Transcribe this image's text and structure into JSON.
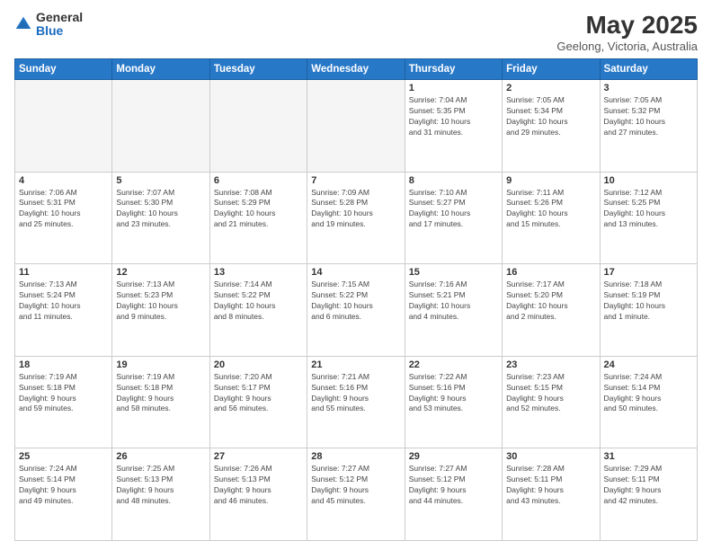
{
  "header": {
    "logo_general": "General",
    "logo_blue": "Blue",
    "title": "May 2025",
    "subtitle": "Geelong, Victoria, Australia"
  },
  "weekdays": [
    "Sunday",
    "Monday",
    "Tuesday",
    "Wednesday",
    "Thursday",
    "Friday",
    "Saturday"
  ],
  "weeks": [
    [
      {
        "day": "",
        "detail": ""
      },
      {
        "day": "",
        "detail": ""
      },
      {
        "day": "",
        "detail": ""
      },
      {
        "day": "",
        "detail": ""
      },
      {
        "day": "1",
        "detail": "Sunrise: 7:04 AM\nSunset: 5:35 PM\nDaylight: 10 hours\nand 31 minutes."
      },
      {
        "day": "2",
        "detail": "Sunrise: 7:05 AM\nSunset: 5:34 PM\nDaylight: 10 hours\nand 29 minutes."
      },
      {
        "day": "3",
        "detail": "Sunrise: 7:05 AM\nSunset: 5:32 PM\nDaylight: 10 hours\nand 27 minutes."
      }
    ],
    [
      {
        "day": "4",
        "detail": "Sunrise: 7:06 AM\nSunset: 5:31 PM\nDaylight: 10 hours\nand 25 minutes."
      },
      {
        "day": "5",
        "detail": "Sunrise: 7:07 AM\nSunset: 5:30 PM\nDaylight: 10 hours\nand 23 minutes."
      },
      {
        "day": "6",
        "detail": "Sunrise: 7:08 AM\nSunset: 5:29 PM\nDaylight: 10 hours\nand 21 minutes."
      },
      {
        "day": "7",
        "detail": "Sunrise: 7:09 AM\nSunset: 5:28 PM\nDaylight: 10 hours\nand 19 minutes."
      },
      {
        "day": "8",
        "detail": "Sunrise: 7:10 AM\nSunset: 5:27 PM\nDaylight: 10 hours\nand 17 minutes."
      },
      {
        "day": "9",
        "detail": "Sunrise: 7:11 AM\nSunset: 5:26 PM\nDaylight: 10 hours\nand 15 minutes."
      },
      {
        "day": "10",
        "detail": "Sunrise: 7:12 AM\nSunset: 5:25 PM\nDaylight: 10 hours\nand 13 minutes."
      }
    ],
    [
      {
        "day": "11",
        "detail": "Sunrise: 7:13 AM\nSunset: 5:24 PM\nDaylight: 10 hours\nand 11 minutes."
      },
      {
        "day": "12",
        "detail": "Sunrise: 7:13 AM\nSunset: 5:23 PM\nDaylight: 10 hours\nand 9 minutes."
      },
      {
        "day": "13",
        "detail": "Sunrise: 7:14 AM\nSunset: 5:22 PM\nDaylight: 10 hours\nand 8 minutes."
      },
      {
        "day": "14",
        "detail": "Sunrise: 7:15 AM\nSunset: 5:22 PM\nDaylight: 10 hours\nand 6 minutes."
      },
      {
        "day": "15",
        "detail": "Sunrise: 7:16 AM\nSunset: 5:21 PM\nDaylight: 10 hours\nand 4 minutes."
      },
      {
        "day": "16",
        "detail": "Sunrise: 7:17 AM\nSunset: 5:20 PM\nDaylight: 10 hours\nand 2 minutes."
      },
      {
        "day": "17",
        "detail": "Sunrise: 7:18 AM\nSunset: 5:19 PM\nDaylight: 10 hours\nand 1 minute."
      }
    ],
    [
      {
        "day": "18",
        "detail": "Sunrise: 7:19 AM\nSunset: 5:18 PM\nDaylight: 9 hours\nand 59 minutes."
      },
      {
        "day": "19",
        "detail": "Sunrise: 7:19 AM\nSunset: 5:18 PM\nDaylight: 9 hours\nand 58 minutes."
      },
      {
        "day": "20",
        "detail": "Sunrise: 7:20 AM\nSunset: 5:17 PM\nDaylight: 9 hours\nand 56 minutes."
      },
      {
        "day": "21",
        "detail": "Sunrise: 7:21 AM\nSunset: 5:16 PM\nDaylight: 9 hours\nand 55 minutes."
      },
      {
        "day": "22",
        "detail": "Sunrise: 7:22 AM\nSunset: 5:16 PM\nDaylight: 9 hours\nand 53 minutes."
      },
      {
        "day": "23",
        "detail": "Sunrise: 7:23 AM\nSunset: 5:15 PM\nDaylight: 9 hours\nand 52 minutes."
      },
      {
        "day": "24",
        "detail": "Sunrise: 7:24 AM\nSunset: 5:14 PM\nDaylight: 9 hours\nand 50 minutes."
      }
    ],
    [
      {
        "day": "25",
        "detail": "Sunrise: 7:24 AM\nSunset: 5:14 PM\nDaylight: 9 hours\nand 49 minutes."
      },
      {
        "day": "26",
        "detail": "Sunrise: 7:25 AM\nSunset: 5:13 PM\nDaylight: 9 hours\nand 48 minutes."
      },
      {
        "day": "27",
        "detail": "Sunrise: 7:26 AM\nSunset: 5:13 PM\nDaylight: 9 hours\nand 46 minutes."
      },
      {
        "day": "28",
        "detail": "Sunrise: 7:27 AM\nSunset: 5:12 PM\nDaylight: 9 hours\nand 45 minutes."
      },
      {
        "day": "29",
        "detail": "Sunrise: 7:27 AM\nSunset: 5:12 PM\nDaylight: 9 hours\nand 44 minutes."
      },
      {
        "day": "30",
        "detail": "Sunrise: 7:28 AM\nSunset: 5:11 PM\nDaylight: 9 hours\nand 43 minutes."
      },
      {
        "day": "31",
        "detail": "Sunrise: 7:29 AM\nSunset: 5:11 PM\nDaylight: 9 hours\nand 42 minutes."
      }
    ]
  ]
}
